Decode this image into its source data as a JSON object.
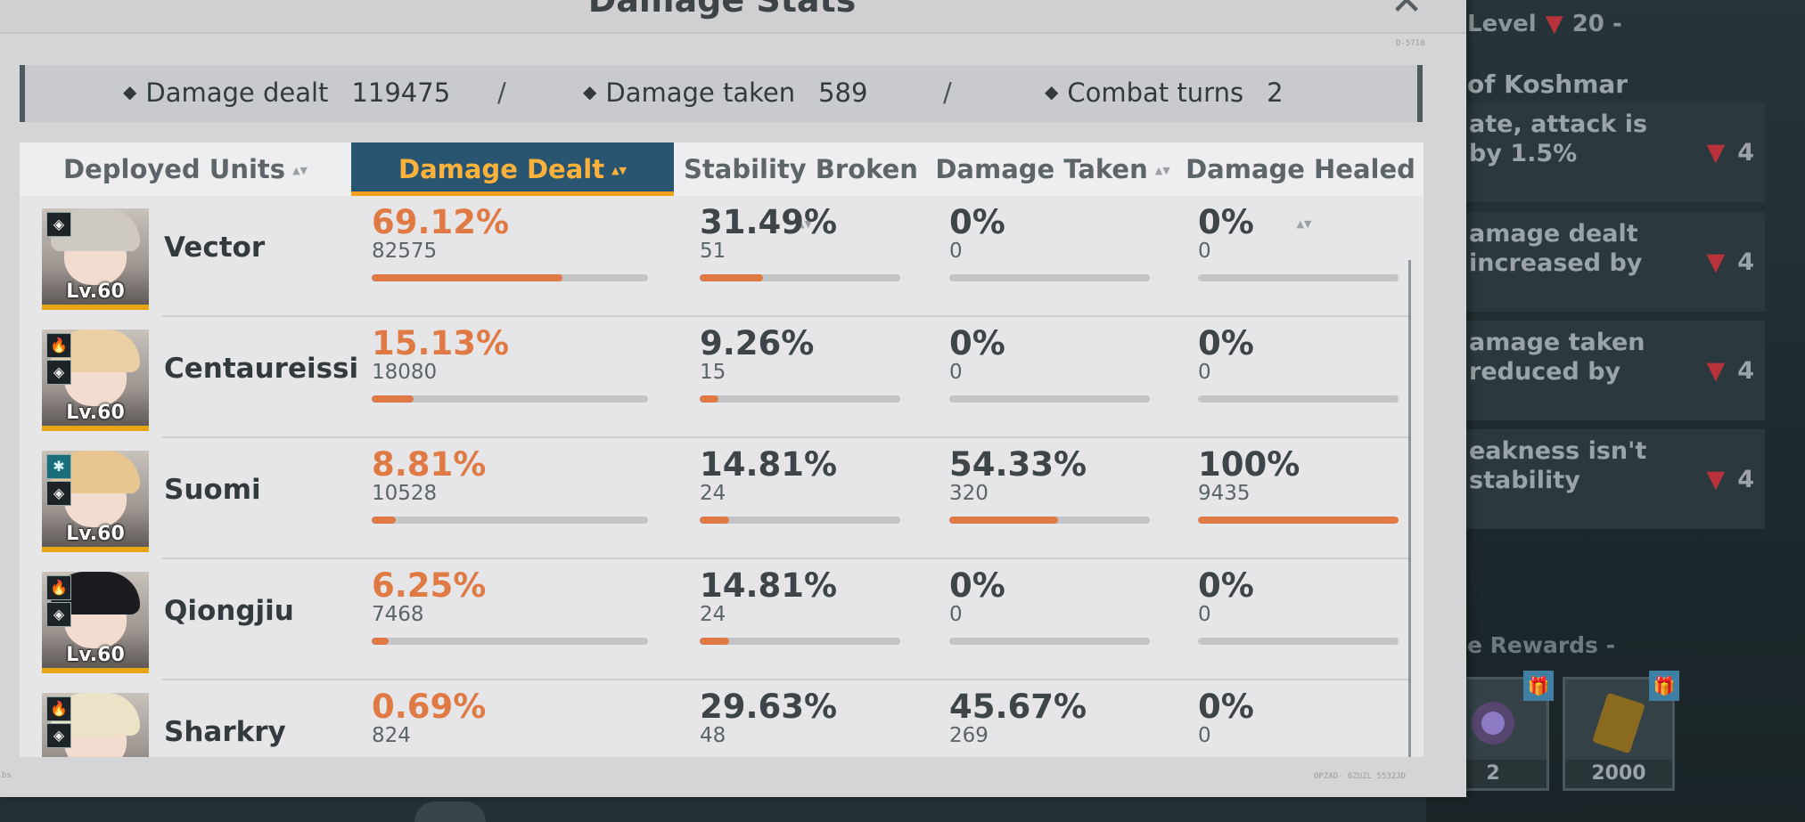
{
  "modal": {
    "title": "Damage Stats",
    "close_icon": "✕",
    "code_top": "D-5710",
    "code_bottom": "OPZAD- 6ZUZL 5532JD",
    "code_left": "bs"
  },
  "summary": {
    "damage_dealt_label": "Damage dealt",
    "damage_dealt_value": "119475",
    "damage_taken_label": "Damage taken",
    "damage_taken_value": "589",
    "combat_turns_label": "Combat turns",
    "combat_turns_value": "2",
    "separator": "/",
    "bullet": "◆"
  },
  "table": {
    "columns": [
      {
        "label": "Deployed Units",
        "active": false
      },
      {
        "label": "Damage Dealt",
        "active": true
      },
      {
        "label": "Stability Broken",
        "active": false
      },
      {
        "label": "Damage Taken",
        "active": false
      },
      {
        "label": "Damage Healed",
        "active": false
      }
    ],
    "sort_icon": "▲▼",
    "rows": [
      {
        "name": "Vector",
        "level": "Lv.60",
        "badges": [
          "role-icon"
        ],
        "hair": "#cfc9c4",
        "damage_dealt": {
          "pct": "69.12%",
          "value": "82575",
          "fraction": 0.6912
        },
        "stability_broken": {
          "pct": "31.49%",
          "value": "51",
          "fraction": 0.3149
        },
        "damage_taken": {
          "pct": "0%",
          "value": "0",
          "fraction": 0
        },
        "damage_healed": {
          "pct": "0%",
          "value": "0",
          "fraction": 0
        }
      },
      {
        "name": "Centaureissi",
        "level": "Lv.60",
        "badges": [
          "fire-icon",
          "role-icon"
        ],
        "hair": "#ead0a4",
        "damage_dealt": {
          "pct": "15.13%",
          "value": "18080",
          "fraction": 0.1513
        },
        "stability_broken": {
          "pct": "9.26%",
          "value": "15",
          "fraction": 0.0926
        },
        "damage_taken": {
          "pct": "0%",
          "value": "0",
          "fraction": 0
        },
        "damage_healed": {
          "pct": "0%",
          "value": "0",
          "fraction": 0
        }
      },
      {
        "name": "Suomi",
        "level": "Lv.60",
        "badges": [
          "ice-icon",
          "role-icon"
        ],
        "hair": "#e7c690",
        "damage_dealt": {
          "pct": "8.81%",
          "value": "10528",
          "fraction": 0.0881
        },
        "stability_broken": {
          "pct": "14.81%",
          "value": "24",
          "fraction": 0.1481
        },
        "damage_taken": {
          "pct": "54.33%",
          "value": "320",
          "fraction": 0.5433
        },
        "damage_healed": {
          "pct": "100%",
          "value": "9435",
          "fraction": 1.0
        }
      },
      {
        "name": "Qiongjiu",
        "level": "Lv.60",
        "badges": [
          "fire-icon",
          "role-icon"
        ],
        "hair": "#1c1c20",
        "damage_dealt": {
          "pct": "6.25%",
          "value": "7468",
          "fraction": 0.0625
        },
        "stability_broken": {
          "pct": "14.81%",
          "value": "24",
          "fraction": 0.1481
        },
        "damage_taken": {
          "pct": "0%",
          "value": "0",
          "fraction": 0
        },
        "damage_healed": {
          "pct": "0%",
          "value": "0",
          "fraction": 0
        }
      },
      {
        "name": "Sharkry",
        "level": "Lv.60",
        "badges": [
          "fire-icon",
          "role-icon"
        ],
        "hair": "#ede3c9",
        "damage_dealt": {
          "pct": "0.69%",
          "value": "824",
          "fraction": 0.0069
        },
        "stability_broken": {
          "pct": "29.63%",
          "value": "48",
          "fraction": 0.2963
        },
        "damage_taken": {
          "pct": "45.67%",
          "value": "269",
          "fraction": 0.4567
        },
        "damage_healed": {
          "pct": "0%",
          "value": "0",
          "fraction": 0
        }
      }
    ]
  },
  "background": {
    "level_label": "Level",
    "level_value": "20",
    "level_dash": "-",
    "title": "of Koshmar",
    "effects": [
      {
        "text": "ate, attack is by 1.5%",
        "level": "4"
      },
      {
        "text": "amage dealt increased by",
        "level": "4"
      },
      {
        "text": "amage taken reduced by",
        "level": "4"
      },
      {
        "text": "eakness isn't stability",
        "level": "4"
      }
    ],
    "rewards_label": "e Rewards",
    "rewards_dash": "-",
    "reward_items": [
      {
        "qty": "2"
      },
      {
        "qty": "2000"
      }
    ],
    "triangle_icon": "▼",
    "gift_icon": "🎁"
  },
  "colors": {
    "accent_orange": "#e07a45",
    "active_header_bg": "#2a5570",
    "active_header_text": "#ffb23a",
    "level_bar": "#e6a312"
  }
}
